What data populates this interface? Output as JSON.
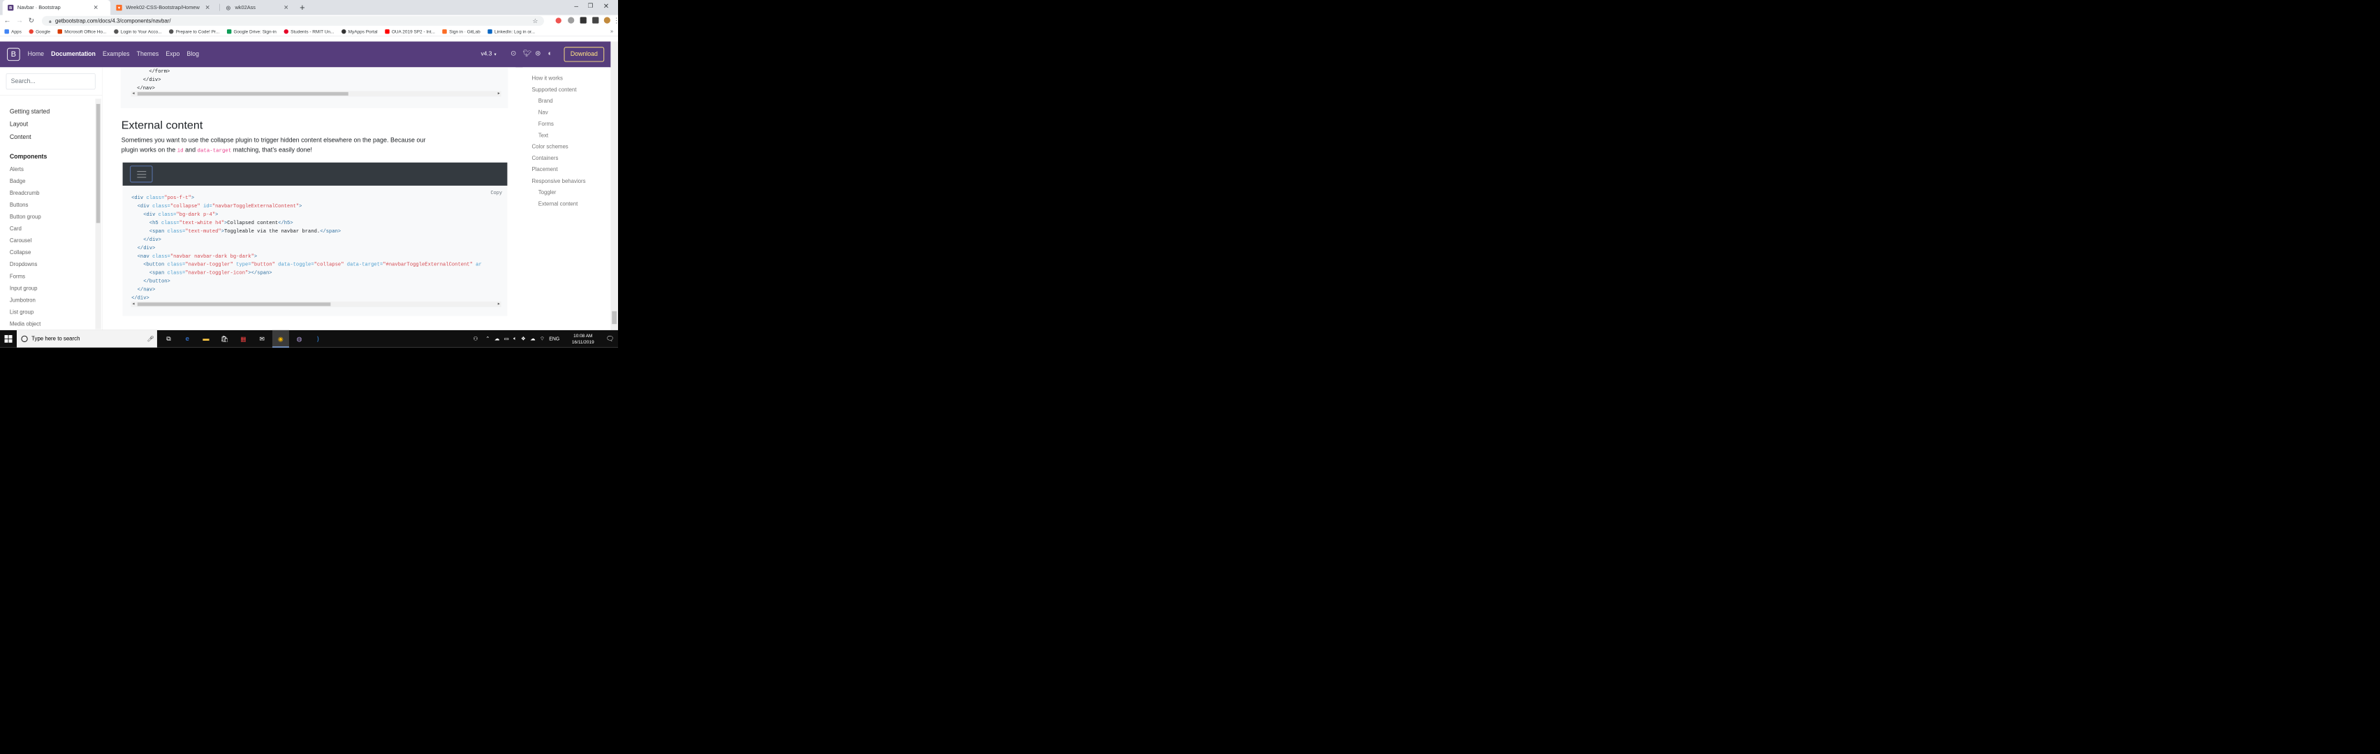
{
  "browser": {
    "tabs": [
      {
        "title": "Navbar · Bootstrap",
        "icon": "bootstrap-b"
      },
      {
        "title": "Week02-CSS-Bootstrap/Homew",
        "icon": "gitlab-icon"
      },
      {
        "title": "wk02Ass",
        "icon": "globe-icon"
      }
    ],
    "url": "getbootstrap.com/docs/4.3/components/navbar/",
    "bookmarks": [
      {
        "label": "Apps",
        "color": "#4285f4"
      },
      {
        "label": "Google",
        "color": "#ea4335"
      },
      {
        "label": "Microsoft Office Ho...",
        "color": "#d83b01"
      },
      {
        "label": "Login to Your Acco...",
        "color": "#555555"
      },
      {
        "label": "Prepare to Code! Pr...",
        "color": "#555555"
      },
      {
        "label": "Google Drive: Sign-in",
        "color": "#0f9d58"
      },
      {
        "label": "Students - RMIT Un...",
        "color": "#e60028"
      },
      {
        "label": "MyApps Portal",
        "color": "#333333"
      },
      {
        "label": "OUA 2019 SP2 - Int...",
        "color": "#ff0000"
      },
      {
        "label": "Sign in · GitLab",
        "color": "#fc6d26"
      },
      {
        "label": "LinkedIn: Log in or...",
        "color": "#0a66c2"
      }
    ]
  },
  "bsnav": {
    "logo": "B",
    "links": [
      "Home",
      "Documentation",
      "Examples",
      "Themes",
      "Expo",
      "Blog"
    ],
    "version": "v4.3",
    "download": "Download"
  },
  "sidebar": {
    "search_placeholder": "Search...",
    "groups": [
      "Getting started",
      "Layout",
      "Content"
    ],
    "components_heading": "Components",
    "components": [
      "Alerts",
      "Badge",
      "Breadcrumb",
      "Buttons",
      "Button group",
      "Card",
      "Carousel",
      "Collapse",
      "Dropdowns",
      "Forms",
      "Input group",
      "Jumbotron",
      "List group",
      "Media object"
    ]
  },
  "main": {
    "top_code": [
      "      </form>",
      "    </div>",
      "  </nav>"
    ],
    "heading": "External content",
    "para_before": "Sometimes you want to use the collapse plugin to trigger hidden content elsewhere on the page. Because our plugin works on the ",
    "code1": "id",
    "para_mid": " and ",
    "code2": "data-target",
    "para_after": " matching, that’s easily done!",
    "copy_label": "Copy"
  },
  "toc": {
    "items": [
      {
        "label": "How it works",
        "level": 1
      },
      {
        "label": "Supported content",
        "level": 1
      },
      {
        "label": "Brand",
        "level": 2
      },
      {
        "label": "Nav",
        "level": 2
      },
      {
        "label": "Forms",
        "level": 2
      },
      {
        "label": "Text",
        "level": 2
      },
      {
        "label": "Color schemes",
        "level": 1
      },
      {
        "label": "Containers",
        "level": 1
      },
      {
        "label": "Placement",
        "level": 1
      },
      {
        "label": "Responsive behaviors",
        "level": 1
      },
      {
        "label": "Toggler",
        "level": 2
      },
      {
        "label": "External content",
        "level": 2
      }
    ]
  },
  "taskbar": {
    "search_placeholder": "Type here to search",
    "lang": "ENG",
    "time": "10:08 AM",
    "date": "16/11/2019"
  }
}
